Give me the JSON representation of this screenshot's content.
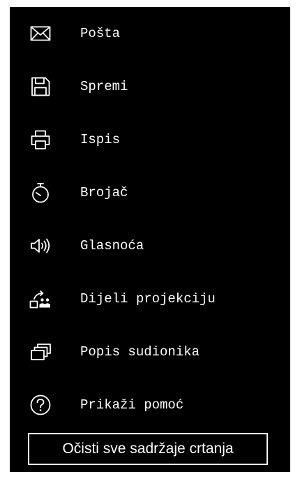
{
  "menu": {
    "items": [
      {
        "label": "Pošta",
        "icon": "mail-icon"
      },
      {
        "label": "Spremi",
        "icon": "save-icon"
      },
      {
        "label": "Ispis",
        "icon": "printer-icon"
      },
      {
        "label": "Brojač",
        "icon": "stopwatch-icon"
      },
      {
        "label": "Glasnoća",
        "icon": "volume-icon"
      },
      {
        "label": "Dijeli projekciju",
        "icon": "share-projection-icon"
      },
      {
        "label": "Popis sudionika",
        "icon": "participants-list-icon"
      },
      {
        "label": "Prikaži pomoć",
        "icon": "help-icon"
      }
    ]
  },
  "clear_button": {
    "label": "Očisti sve sadržaje crtanja"
  },
  "colors": {
    "background": "#000000",
    "foreground": "#ffffff",
    "page": "#ffffff"
  }
}
